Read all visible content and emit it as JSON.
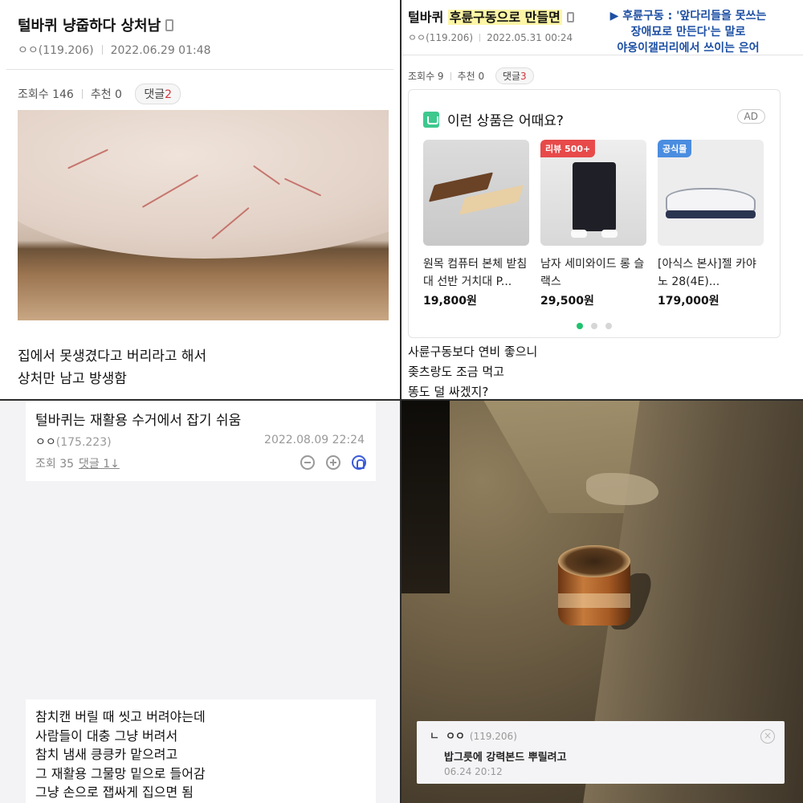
{
  "panel1": {
    "title": "털바퀴 냥줍하다 상처남",
    "author": "ㅇㅇ(119.206)",
    "date": "2022.06.29 01:48",
    "views_label": "조회수 146",
    "recommend_label": "추천 0",
    "comment_label": "댓글",
    "comment_count": "2",
    "body_lines": [
      "집에서 못생겼다고 버리라고 해서",
      "상처만 남고 방생함"
    ]
  },
  "panel2": {
    "title_prefix": "털바퀴 ",
    "title_highlight": "후륜구동으로 만들면",
    "author": "ㅇㅇ(119.206)",
    "date": "2022.05.31 00:24",
    "note_lines": [
      "▶ 후륜구동 : '앞다리들을 못쓰는",
      "장애묘로 만든다'는 말로",
      "야옹이갤러리에서 쓰이는 은어"
    ],
    "views_label": "조회수 9",
    "recommend_label": "추천 0",
    "comment_label": "댓글",
    "comment_count": "3",
    "ad": {
      "heading": "이런 상품은 어때요?",
      "badge": "AD",
      "products": [
        {
          "name": "원목 컴퓨터 본체 받침대 선반 거치대 P...",
          "price": "19,800원",
          "tag": ""
        },
        {
          "name": "남자 세미와이드 롱 슬랙스",
          "price": "29,500원",
          "tag": "리뷰 500+"
        },
        {
          "name": "[아식스 본사]젤 카야노 28(4E)...",
          "price": "179,000원",
          "tag": "공식몰"
        }
      ]
    },
    "body_lines": [
      "사륜구동보다 연비 좋으니",
      "좆츠랑도 조금 먹고",
      "똥도 덜 싸겠지?"
    ]
  },
  "panel3": {
    "title": "털바퀴는 재활용 수거에서 잡기 쉬움",
    "author": "ㅇㅇ",
    "ip": "(175.223)",
    "date": "2022.08.09 22:24",
    "views_label": "조회 35",
    "comment_label": "댓글 1↓",
    "body_lines": [
      "참치캔 버릴 때 씻고 버려야는데",
      "사람들이 대충 그냥 버려서",
      "참치 냄새 킁킁카 맡으려고",
      "그 재활용 그물망 밑으로 들어감",
      "그냥 손으로 잽싸게 집으면 됨"
    ]
  },
  "panel4": {
    "comment_reply": "ㄴ",
    "comment_author": "ㅇㅇ",
    "comment_ip": "(119.206)",
    "comment_text": "밥그릇에 강력본드 뿌릴려고",
    "comment_date": "06.24 20:12"
  },
  "colors": {
    "comment_count": "#d0353f",
    "highlight": "#fdf6a6",
    "note_text": "#1d4fa3",
    "dot_active": "#1ec36d",
    "tag_review": "#e84a4a",
    "tag_official": "#4a8de0"
  },
  "icons": [
    "mobile-icon",
    "ad-bag-icon",
    "zoom-out-icon",
    "zoom-in-icon",
    "bell-icon",
    "close-icon"
  ]
}
